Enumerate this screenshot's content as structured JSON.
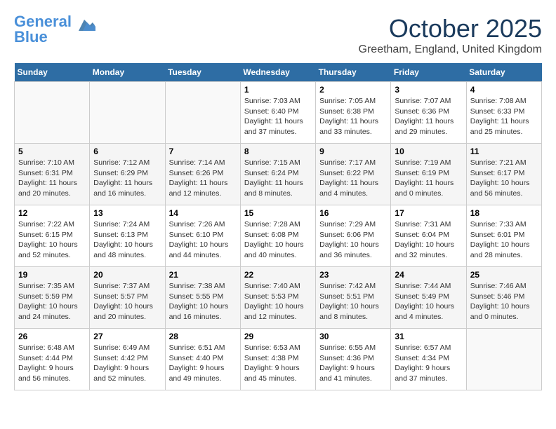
{
  "logo": {
    "line1": "General",
    "line2": "Blue"
  },
  "title": "October 2025",
  "subtitle": "Greetham, England, United Kingdom",
  "weekdays": [
    "Sunday",
    "Monday",
    "Tuesday",
    "Wednesday",
    "Thursday",
    "Friday",
    "Saturday"
  ],
  "weeks": [
    [
      {
        "day": "",
        "detail": ""
      },
      {
        "day": "",
        "detail": ""
      },
      {
        "day": "",
        "detail": ""
      },
      {
        "day": "1",
        "detail": "Sunrise: 7:03 AM\nSunset: 6:40 PM\nDaylight: 11 hours\nand 37 minutes."
      },
      {
        "day": "2",
        "detail": "Sunrise: 7:05 AM\nSunset: 6:38 PM\nDaylight: 11 hours\nand 33 minutes."
      },
      {
        "day": "3",
        "detail": "Sunrise: 7:07 AM\nSunset: 6:36 PM\nDaylight: 11 hours\nand 29 minutes."
      },
      {
        "day": "4",
        "detail": "Sunrise: 7:08 AM\nSunset: 6:33 PM\nDaylight: 11 hours\nand 25 minutes."
      }
    ],
    [
      {
        "day": "5",
        "detail": "Sunrise: 7:10 AM\nSunset: 6:31 PM\nDaylight: 11 hours\nand 20 minutes."
      },
      {
        "day": "6",
        "detail": "Sunrise: 7:12 AM\nSunset: 6:29 PM\nDaylight: 11 hours\nand 16 minutes."
      },
      {
        "day": "7",
        "detail": "Sunrise: 7:14 AM\nSunset: 6:26 PM\nDaylight: 11 hours\nand 12 minutes."
      },
      {
        "day": "8",
        "detail": "Sunrise: 7:15 AM\nSunset: 6:24 PM\nDaylight: 11 hours\nand 8 minutes."
      },
      {
        "day": "9",
        "detail": "Sunrise: 7:17 AM\nSunset: 6:22 PM\nDaylight: 11 hours\nand 4 minutes."
      },
      {
        "day": "10",
        "detail": "Sunrise: 7:19 AM\nSunset: 6:19 PM\nDaylight: 11 hours\nand 0 minutes."
      },
      {
        "day": "11",
        "detail": "Sunrise: 7:21 AM\nSunset: 6:17 PM\nDaylight: 10 hours\nand 56 minutes."
      }
    ],
    [
      {
        "day": "12",
        "detail": "Sunrise: 7:22 AM\nSunset: 6:15 PM\nDaylight: 10 hours\nand 52 minutes."
      },
      {
        "day": "13",
        "detail": "Sunrise: 7:24 AM\nSunset: 6:13 PM\nDaylight: 10 hours\nand 48 minutes."
      },
      {
        "day": "14",
        "detail": "Sunrise: 7:26 AM\nSunset: 6:10 PM\nDaylight: 10 hours\nand 44 minutes."
      },
      {
        "day": "15",
        "detail": "Sunrise: 7:28 AM\nSunset: 6:08 PM\nDaylight: 10 hours\nand 40 minutes."
      },
      {
        "day": "16",
        "detail": "Sunrise: 7:29 AM\nSunset: 6:06 PM\nDaylight: 10 hours\nand 36 minutes."
      },
      {
        "day": "17",
        "detail": "Sunrise: 7:31 AM\nSunset: 6:04 PM\nDaylight: 10 hours\nand 32 minutes."
      },
      {
        "day": "18",
        "detail": "Sunrise: 7:33 AM\nSunset: 6:01 PM\nDaylight: 10 hours\nand 28 minutes."
      }
    ],
    [
      {
        "day": "19",
        "detail": "Sunrise: 7:35 AM\nSunset: 5:59 PM\nDaylight: 10 hours\nand 24 minutes."
      },
      {
        "day": "20",
        "detail": "Sunrise: 7:37 AM\nSunset: 5:57 PM\nDaylight: 10 hours\nand 20 minutes."
      },
      {
        "day": "21",
        "detail": "Sunrise: 7:38 AM\nSunset: 5:55 PM\nDaylight: 10 hours\nand 16 minutes."
      },
      {
        "day": "22",
        "detail": "Sunrise: 7:40 AM\nSunset: 5:53 PM\nDaylight: 10 hours\nand 12 minutes."
      },
      {
        "day": "23",
        "detail": "Sunrise: 7:42 AM\nSunset: 5:51 PM\nDaylight: 10 hours\nand 8 minutes."
      },
      {
        "day": "24",
        "detail": "Sunrise: 7:44 AM\nSunset: 5:49 PM\nDaylight: 10 hours\nand 4 minutes."
      },
      {
        "day": "25",
        "detail": "Sunrise: 7:46 AM\nSunset: 5:46 PM\nDaylight: 10 hours\nand 0 minutes."
      }
    ],
    [
      {
        "day": "26",
        "detail": "Sunrise: 6:48 AM\nSunset: 4:44 PM\nDaylight: 9 hours\nand 56 minutes."
      },
      {
        "day": "27",
        "detail": "Sunrise: 6:49 AM\nSunset: 4:42 PM\nDaylight: 9 hours\nand 52 minutes."
      },
      {
        "day": "28",
        "detail": "Sunrise: 6:51 AM\nSunset: 4:40 PM\nDaylight: 9 hours\nand 49 minutes."
      },
      {
        "day": "29",
        "detail": "Sunrise: 6:53 AM\nSunset: 4:38 PM\nDaylight: 9 hours\nand 45 minutes."
      },
      {
        "day": "30",
        "detail": "Sunrise: 6:55 AM\nSunset: 4:36 PM\nDaylight: 9 hours\nand 41 minutes."
      },
      {
        "day": "31",
        "detail": "Sunrise: 6:57 AM\nSunset: 4:34 PM\nDaylight: 9 hours\nand 37 minutes."
      },
      {
        "day": "",
        "detail": ""
      }
    ]
  ]
}
